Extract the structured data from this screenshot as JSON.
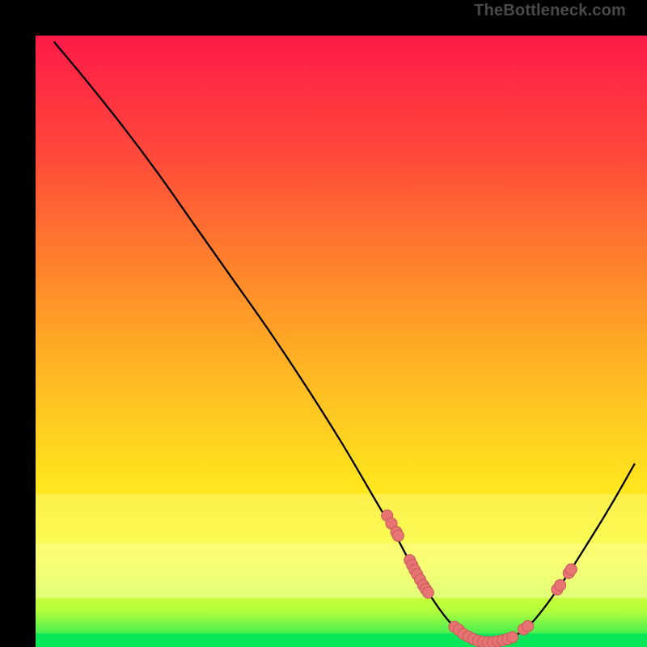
{
  "watermark": "TheBottleneck.com",
  "chart_data": {
    "type": "line",
    "title": "",
    "xlabel": "",
    "ylabel": "",
    "xlim": [
      0,
      100
    ],
    "ylim": [
      0,
      100
    ],
    "grid": false,
    "legend": false,
    "gradient_top": "#ff1a48",
    "gradient_bottom": "#08e65a",
    "series": [
      {
        "name": "curve",
        "x": [
          3,
          8,
          14,
          20,
          26,
          32,
          38,
          44,
          50,
          55,
          58.5,
          62,
          65.5,
          68,
          70.5,
          73,
          75.5,
          78,
          81,
          84,
          87,
          90,
          94,
          98
        ],
        "y": [
          99,
          93,
          85.5,
          77.5,
          69,
          60.5,
          52,
          43,
          33.5,
          25,
          19,
          12.5,
          7,
          3.8,
          1.8,
          0.8,
          0.8,
          1.6,
          3.8,
          7.5,
          11.8,
          16.5,
          23,
          30
        ],
        "color": "#000000",
        "width": 2.3
      }
    ],
    "bands": [
      {
        "name": "yellow-band",
        "y0": 17,
        "y1": 25,
        "color": "rgba(255,255,160,0.35)"
      },
      {
        "name": "pale-yellow-band",
        "y0": 8,
        "y1": 17,
        "color": "rgba(255,255,200,0.45)"
      },
      {
        "name": "green-band",
        "y0": 0,
        "y1": 2.2,
        "color": "#08e65a"
      }
    ],
    "markers": {
      "color": "#e87373",
      "radius": 7,
      "stroke": "#c85a5a",
      "points_xy": [
        [
          57.5,
          21.5
        ],
        [
          58.2,
          20.2
        ],
        [
          59.0,
          18.8
        ],
        [
          59.3,
          18.2
        ],
        [
          61.2,
          14.2
        ],
        [
          61.6,
          13.4
        ],
        [
          62.0,
          12.6
        ],
        [
          62.4,
          11.9
        ],
        [
          62.9,
          11.0
        ],
        [
          63.4,
          10.1
        ],
        [
          63.8,
          9.5
        ],
        [
          64.2,
          8.9
        ],
        [
          68.5,
          3.3
        ],
        [
          69.2,
          2.8
        ],
        [
          70.0,
          2.1
        ],
        [
          70.8,
          1.7
        ],
        [
          71.6,
          1.3
        ],
        [
          72.4,
          1.0
        ],
        [
          73.2,
          0.85
        ],
        [
          74.0,
          0.8
        ],
        [
          74.8,
          0.82
        ],
        [
          75.6,
          0.92
        ],
        [
          76.4,
          1.1
        ],
        [
          77.2,
          1.3
        ],
        [
          78.0,
          1.6
        ],
        [
          79.8,
          2.9
        ],
        [
          80.5,
          3.4
        ],
        [
          85.3,
          9.4
        ],
        [
          85.8,
          10.1
        ],
        [
          87.2,
          12.1
        ],
        [
          87.6,
          12.7
        ]
      ]
    }
  }
}
